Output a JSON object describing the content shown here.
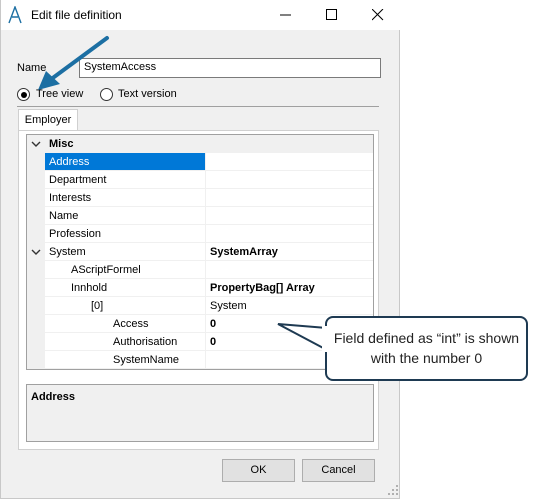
{
  "window": {
    "title": "Edit file definition",
    "minimize_icon": "minimize-icon",
    "maximize_icon": "maximize-icon",
    "close_icon": "close-icon"
  },
  "form": {
    "name_label": "Name",
    "name_value": "SystemAccess",
    "view_options": [
      {
        "label": "Tree view",
        "selected": true
      },
      {
        "label": "Text version",
        "selected": false
      }
    ]
  },
  "tabs": [
    {
      "label": "Employer",
      "selected": true
    }
  ],
  "property_grid": {
    "rows": [
      {
        "name": "Misc",
        "value": "",
        "type": "category",
        "expanded": true
      },
      {
        "name": "Address",
        "value": "",
        "selected": true
      },
      {
        "name": "Department",
        "value": ""
      },
      {
        "name": "Interests",
        "value": ""
      },
      {
        "name": "Name",
        "value": ""
      },
      {
        "name": "Profession",
        "value": ""
      },
      {
        "name": "System",
        "value": "SystemArray",
        "expanded": true,
        "value_bold": true
      },
      {
        "name": "AScriptFormel",
        "value": ""
      },
      {
        "name": "Innhold",
        "value": "PropertyBag[] Array",
        "expanded": true,
        "value_bold": true
      },
      {
        "name": "[0]",
        "value": "System",
        "expanded": true
      },
      {
        "name": "Access",
        "value": "0",
        "value_bold": true
      },
      {
        "name": "Authorisation",
        "value": "0",
        "value_bold": true
      },
      {
        "name": "SystemName",
        "value": ""
      }
    ]
  },
  "description": {
    "title": "Address"
  },
  "buttons": {
    "ok": "OK",
    "cancel": "Cancel"
  },
  "callout": {
    "text": "Field defined as “int” is shown with the number 0"
  },
  "colors": {
    "selection": "#0078d7",
    "arrow": "#1c6fa3",
    "callout_border": "#1e3a52"
  }
}
